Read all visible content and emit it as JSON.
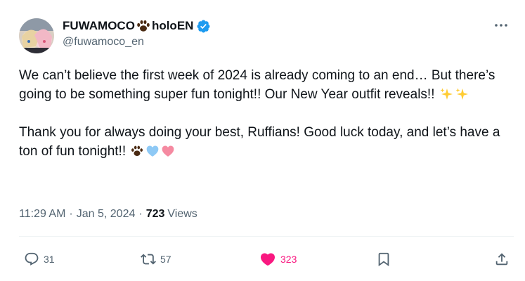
{
  "author": {
    "name_part1": "FUWAMOCO",
    "name_part2": "holoEN",
    "handle": "@fuwamoco_en",
    "verified": true
  },
  "tweet": {
    "paragraph1": "We can’t believe the first week of 2024 is already coming to an end… But there’s going to be something super fun tonight!! Our New Year outfit reveals!!",
    "paragraph2": "Thank you for always doing your best, Ruffians! Good luck today, and let’s have a ton of fun tonight!!"
  },
  "meta": {
    "time": "11:29 AM",
    "separator": "·",
    "date": "Jan 5, 2024",
    "views_count": "723",
    "views_label": "Views"
  },
  "actions": {
    "replies": "31",
    "reposts": "57",
    "likes": "323"
  },
  "colors": {
    "text": "#0f1419",
    "secondary": "#536471",
    "verified": "#1d9bf0",
    "like": "#f91880"
  },
  "icons": [
    "more-icon",
    "verified-icon",
    "paw-icon",
    "sparkles-icon",
    "blue-heart-icon",
    "pink-heart-icon",
    "reply-icon",
    "repost-icon",
    "like-icon",
    "bookmark-icon",
    "share-icon"
  ]
}
